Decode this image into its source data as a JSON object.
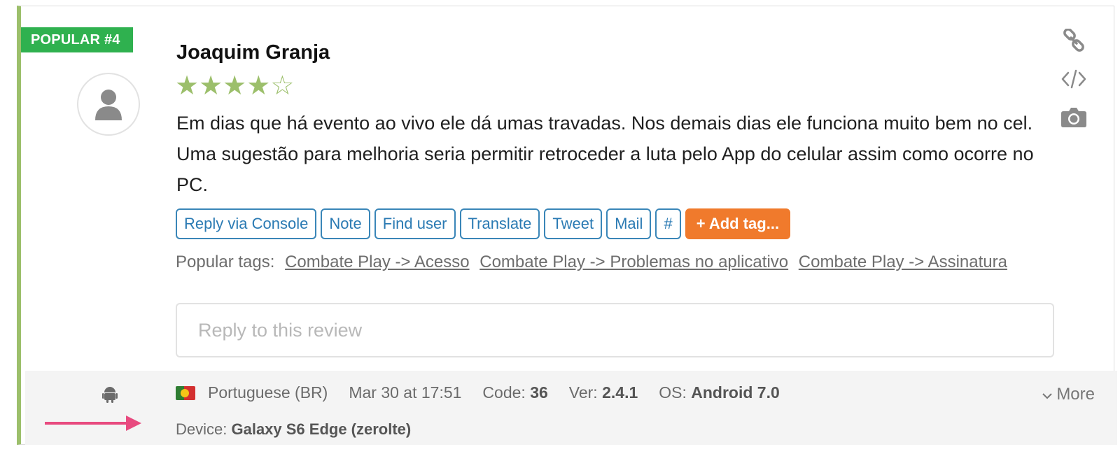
{
  "badge": "POPULAR #4",
  "review": {
    "author": "Joaquim Granja",
    "rating": 4,
    "rating_max": 5,
    "star_filled": "★",
    "star_empty": "☆",
    "text": "Em dias que há evento ao vivo ele dá umas travadas. Nos demais dias ele funciona muito bem no cel. Uma sugestão para melhoria seria permitir retroceder a luta pelo App do celular assim como ocorre no PC."
  },
  "actions": {
    "reply_console": "Reply via Console",
    "note": "Note",
    "find_user": "Find user",
    "translate": "Translate",
    "tweet": "Tweet",
    "mail": "Mail",
    "hash": "#",
    "add_tag": "+ Add tag..."
  },
  "popular_tags": {
    "label": "Popular tags:",
    "tags": [
      "Combate Play -> Acesso",
      "Combate Play -> Problemas no aplicativo",
      "Combate Play -> Assinatura"
    ]
  },
  "reply": {
    "placeholder": "Reply to this review"
  },
  "side_icons": [
    "link-icon",
    "code-icon",
    "camera-icon"
  ],
  "meta": {
    "platform_icon": "android-icon",
    "flag_icon": "portugal-flag-icon",
    "language": "Portuguese (BR)",
    "date": "Mar 30 at 17:51",
    "code_label": "Code:",
    "code_value": "36",
    "ver_label": "Ver:",
    "ver_value": "2.4.1",
    "os_label": "OS:",
    "os_value": "Android 7.0",
    "more": "More",
    "device_label": "Device:",
    "device_value": "Galaxy S6 Edge (zerolte)"
  },
  "colors": {
    "badge": "#2fb14f",
    "accent_bar": "#9cbf6b",
    "button_border": "#3a86b8",
    "add_tag": "#f07a2c",
    "arrow": "#e84a7f"
  }
}
